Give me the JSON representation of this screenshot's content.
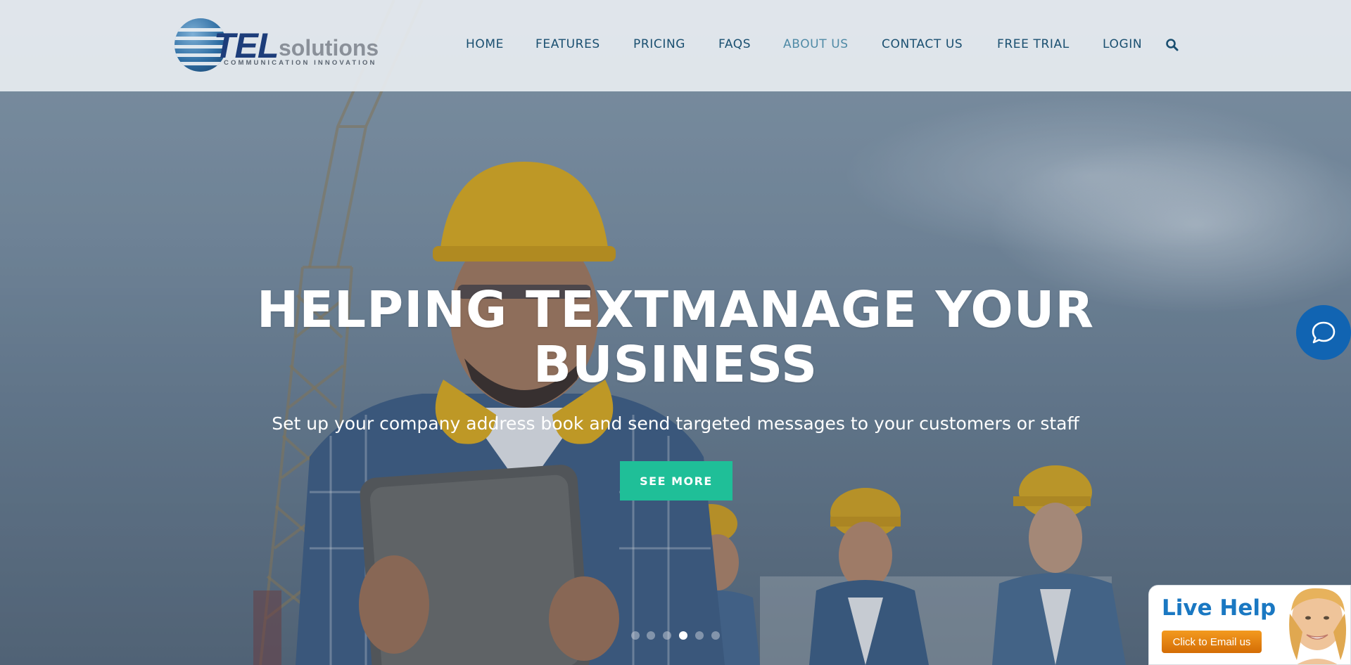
{
  "brand": {
    "logo_main": "TEL",
    "logo_sub": "solutions",
    "tagline": "COMMUNICATION INNOVATION"
  },
  "nav": {
    "items": [
      {
        "label": "HOME",
        "active": false
      },
      {
        "label": "FEATURES",
        "active": false
      },
      {
        "label": "PRICING",
        "active": false
      },
      {
        "label": "FAQS",
        "active": false
      },
      {
        "label": "ABOUT US",
        "active": true
      },
      {
        "label": "CONTACT US",
        "active": false
      },
      {
        "label": "FREE TRIAL",
        "active": false
      },
      {
        "label": "LOGIN",
        "active": false
      }
    ],
    "search_icon": "search-icon"
  },
  "hero": {
    "headline_line1": "HELPING TEXTMANAGE YOUR",
    "headline_line2": "BUSINESS",
    "subheadline": "Set up your company address book and send targeted messages to your customers or staff",
    "cta_label": "SEE MORE",
    "slides_total": 6,
    "active_slide": 4
  },
  "chat": {
    "icon": "chat-bubble-icon"
  },
  "live_help": {
    "title": "Live Help",
    "button_label": "Click to Email us"
  },
  "colors": {
    "nav_text": "#1a4f70",
    "nav_active": "#4f8aa6",
    "cta_bg": "#1fbf98",
    "chat_bg": "#1164b2",
    "live_help_title": "#1a78c2",
    "live_help_button": "#e8860f"
  }
}
